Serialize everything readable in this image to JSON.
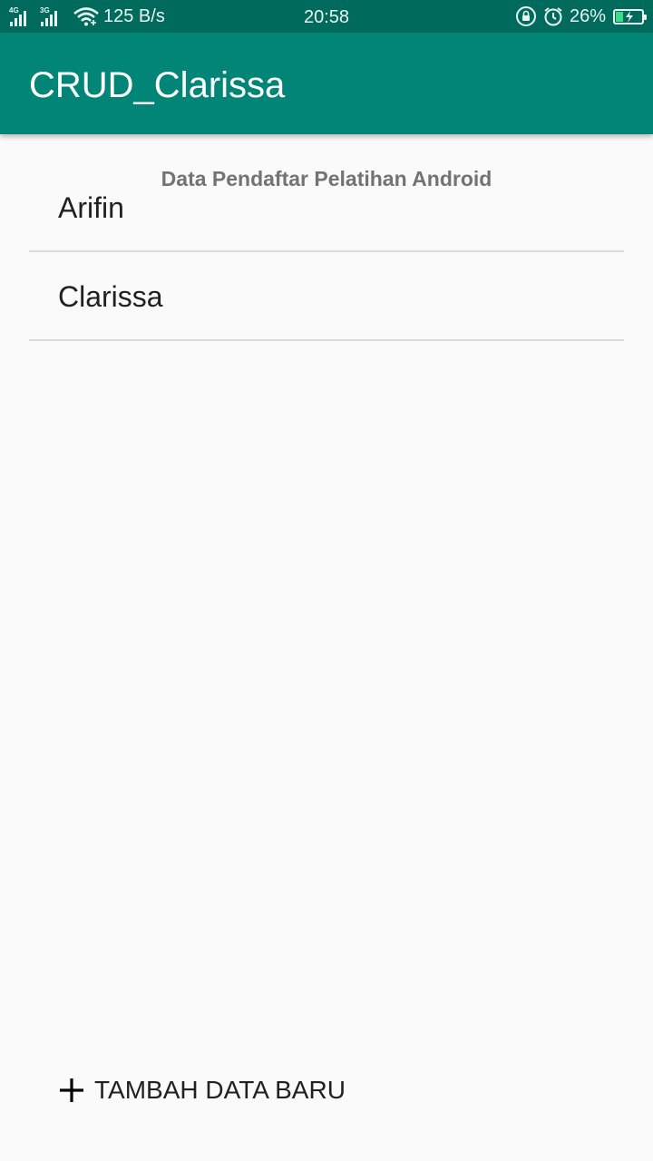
{
  "status_bar": {
    "signal_1": "4G",
    "signal_2": "3G",
    "speed": "125 B/s",
    "time": "20:58",
    "battery": "26%",
    "battery_level": 0.26
  },
  "app_bar": {
    "title": "CRUD_Clarissa",
    "color": "#008577"
  },
  "main": {
    "subtitle": "Data Pendaftar Pelatihan Android",
    "items": [
      {
        "label": "Arifin"
      },
      {
        "label": "Clarissa"
      }
    ],
    "add_button_label": "TAMBAH DATA BARU",
    "add_icon": "plus-icon"
  }
}
